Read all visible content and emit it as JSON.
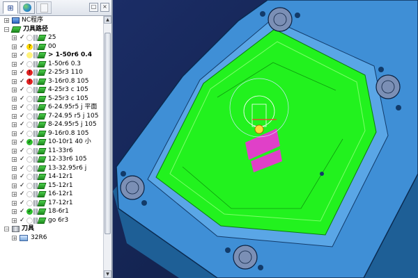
{
  "panel": {
    "controls": [
      "□",
      "×"
    ]
  },
  "tree": {
    "nc_programs": "NC程序",
    "toolpaths": "刀具路径",
    "tools": "刀具",
    "paths": [
      {
        "label": "25",
        "status": "ok"
      },
      {
        "label": "00",
        "status": "warn"
      },
      {
        "label": "> 1-50r6  0.4",
        "status": "active",
        "bold": true
      },
      {
        "label": "1-50r6   0.3",
        "status": "ok"
      },
      {
        "label": "2-25r3   110",
        "status": "error"
      },
      {
        "label": "3-16r0.8   105",
        "status": "error"
      },
      {
        "label": "4-25r3   c  105",
        "status": "ok"
      },
      {
        "label": "5-25r3  c  105",
        "status": "ok"
      },
      {
        "label": "6-24.95r5  j  平面",
        "status": "ok"
      },
      {
        "label": "7-24.95 r5  j  105",
        "status": "ok"
      },
      {
        "label": "8-24.95r5   j  105",
        "status": "ok"
      },
      {
        "label": "9-16r0.8   105",
        "status": "ok"
      },
      {
        "label": "10-10r1    40  小",
        "status": "done"
      },
      {
        "label": "11-33r6",
        "status": "ok"
      },
      {
        "label": "12-33r6  105",
        "status": "ok"
      },
      {
        "label": "13-32.95r6 j",
        "status": "ok"
      },
      {
        "label": "14-12r1",
        "status": "ok"
      },
      {
        "label": "15-12r1",
        "status": "ok"
      },
      {
        "label": "16-12r1",
        "status": "ok"
      },
      {
        "label": "17-12r1",
        "status": "ok"
      },
      {
        "label": "18-6r1",
        "status": "done"
      },
      {
        "label": "go  6r3",
        "status": "ok"
      }
    ],
    "tool_items": [
      {
        "label": "32R6"
      }
    ]
  },
  "colors": {
    "viewport_bg": "#1b2d66",
    "mold_base": "#3f8fd6",
    "toolpath": "#22f21e",
    "highlight": "#e040c8"
  }
}
